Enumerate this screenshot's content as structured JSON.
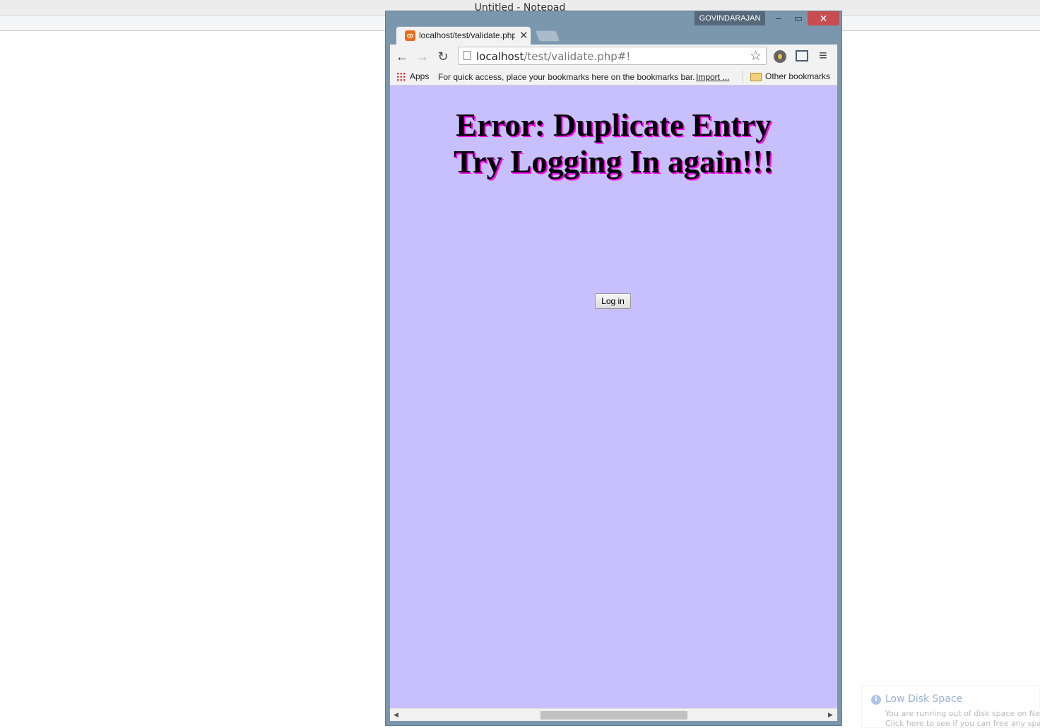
{
  "notepad": {
    "title": "Untitled - Notepad"
  },
  "chrome": {
    "profile_name": "GOVINDARAJAN",
    "window_buttons": {
      "minimize": "‒",
      "maximize": "▭",
      "close": "✕"
    },
    "tab": {
      "title": "localhost/test/validate.php",
      "favicon_text": "ꝏ",
      "close": "✕"
    },
    "toolbar": {
      "back": "←",
      "forward": "→",
      "reload": "↻",
      "star": "☆",
      "menu": "≡"
    },
    "address": {
      "host": "localhost",
      "path": "/test/validate.php#!"
    },
    "bookmarks_bar": {
      "apps_label": "Apps",
      "hint": "For quick access, place your bookmarks here on the bookmarks bar.",
      "import_link": "Import ...",
      "other_bookmarks": "Other bookmarks"
    },
    "page": {
      "background": "#c8bfff",
      "heading_line1": "Error: Duplicate Entry",
      "heading_line2": "Try Logging In again!!!",
      "login_button": "Log in"
    },
    "scrollbar": {
      "left": "◀",
      "right": "▶"
    }
  },
  "notification": {
    "title": "Low Disk Space",
    "line1": "You are running out of disk space on New",
    "line2": "Click here to see if you can free any space"
  }
}
